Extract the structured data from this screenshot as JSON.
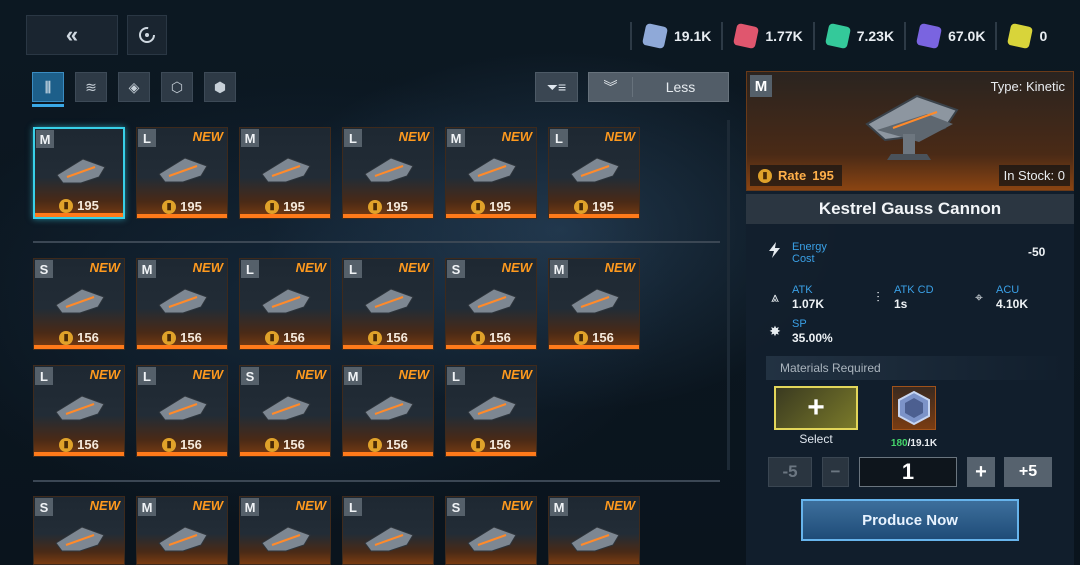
{
  "topbar": {
    "back_icon": "double-chevron-left-icon",
    "refresh_icon": "refresh-icon"
  },
  "resources": [
    {
      "icon": "blue-crystal-icon",
      "value": "19.1K",
      "color": "#8fa9d8"
    },
    {
      "icon": "red-crystal-icon",
      "value": "1.77K",
      "color": "#e0566e"
    },
    {
      "icon": "green-crystal-icon",
      "value": "7.23K",
      "color": "#34c99a"
    },
    {
      "icon": "purple-crystal-icon",
      "value": "67.0K",
      "color": "#7a64e0"
    },
    {
      "icon": "yellow-cube-icon",
      "value": "0",
      "color": "#d8d43a"
    }
  ],
  "filter": {
    "tabs": [
      "ammo-icon",
      "thrusters-icon",
      "layers-icon",
      "module-icon",
      "cube-stack-icon"
    ],
    "active_tab": 0,
    "less_label": "Less"
  },
  "grid": {
    "row1": [
      {
        "size": "M",
        "new": "",
        "cost": "195",
        "selected": true
      },
      {
        "size": "L",
        "new": "NEW",
        "cost": "195"
      },
      {
        "size": "M",
        "new": "",
        "cost": "195"
      },
      {
        "size": "L",
        "new": "NEW",
        "cost": "195"
      },
      {
        "size": "M",
        "new": "NEW",
        "cost": "195"
      },
      {
        "size": "L",
        "new": "NEW",
        "cost": "195"
      }
    ],
    "row2": [
      {
        "size": "S",
        "new": "NEW",
        "cost": "156"
      },
      {
        "size": "M",
        "new": "NEW",
        "cost": "156"
      },
      {
        "size": "L",
        "new": "NEW",
        "cost": "156"
      },
      {
        "size": "L",
        "new": "NEW",
        "cost": "156"
      },
      {
        "size": "S",
        "new": "NEW",
        "cost": "156"
      },
      {
        "size": "M",
        "new": "NEW",
        "cost": "156"
      }
    ],
    "row3": [
      {
        "size": "L",
        "new": "NEW",
        "cost": "156"
      },
      {
        "size": "L",
        "new": "NEW",
        "cost": "156"
      },
      {
        "size": "S",
        "new": "NEW",
        "cost": "156"
      },
      {
        "size": "M",
        "new": "NEW",
        "cost": "156"
      },
      {
        "size": "L",
        "new": "NEW",
        "cost": "156"
      }
    ],
    "row4": [
      {
        "size": "S",
        "new": "NEW",
        "cost": ""
      },
      {
        "size": "M",
        "new": "NEW",
        "cost": ""
      },
      {
        "size": "M",
        "new": "NEW",
        "cost": ""
      },
      {
        "size": "L",
        "new": "",
        "cost": ""
      },
      {
        "size": "S",
        "new": "NEW",
        "cost": ""
      },
      {
        "size": "M",
        "new": "NEW",
        "cost": ""
      }
    ]
  },
  "detail": {
    "size": "M",
    "type": "Type: Kinetic",
    "rate_label": "Rate",
    "rate_value": "195",
    "stock": "In Stock: 0",
    "name": "Kestrel Gauss Cannon",
    "energy_label": "Energy",
    "energy_label2": "Cost",
    "energy_value": "-50",
    "atk_label": "ATK",
    "atk_value": "1.07K",
    "atkcd_label": "ATK CD",
    "atkcd_value": "1s",
    "acu_label": "ACU",
    "acu_value": "4.10K",
    "sp_label": "SP",
    "sp_value": "35.00%",
    "materials_label": "Materials Required",
    "select_label": "Select",
    "mat_have": "180",
    "mat_need": "/19.1K",
    "qty_minus5": "-5",
    "qty_minus1": "−",
    "qty_value": "1",
    "qty_plus1": "+",
    "qty_plus5": "+5",
    "produce_label": "Produce Now"
  }
}
